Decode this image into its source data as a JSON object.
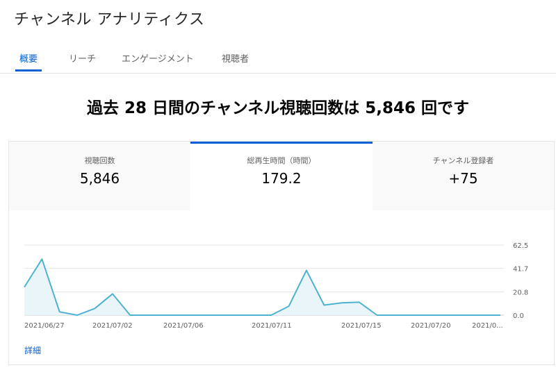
{
  "header": {
    "title": "チャンネル アナリティクス"
  },
  "tabs": [
    {
      "label": "概要",
      "active": true
    },
    {
      "label": "リーチ",
      "active": false
    },
    {
      "label": "エンゲージメント",
      "active": false
    },
    {
      "label": "視聴者",
      "active": false
    }
  ],
  "headline": "過去 28 日間のチャンネル視聴回数は 5,846 回です",
  "metrics": [
    {
      "label": "視聴回数",
      "value": "5,846",
      "active": false
    },
    {
      "label": "総再生時間（時間）",
      "value": "179.2",
      "active": true
    },
    {
      "label": "チャンネル登録者",
      "value": "+75",
      "active": false
    }
  ],
  "details_link": "詳細",
  "colors": {
    "accent": "#065fd4",
    "line": "#4db2d1",
    "fill": "#e8f4fa"
  },
  "chart_data": {
    "type": "area",
    "x_tick_labels": [
      "2021/06/27",
      "2021/07/02",
      "2021/07/06",
      "2021/07/11",
      "2021/07/15",
      "2021/07/20",
      "2021/0..."
    ],
    "y_ticks": [
      0.0,
      20.8,
      41.7,
      62.5
    ],
    "y_tick_labels": [
      "0.0",
      "20.8",
      "41.7",
      "62.5"
    ],
    "ylim": [
      0,
      62.5
    ],
    "x": [
      "2021/06/26",
      "2021/06/27",
      "2021/06/28",
      "2021/06/29",
      "2021/06/30",
      "2021/07/01",
      "2021/07/02",
      "2021/07/03",
      "2021/07/04",
      "2021/07/05",
      "2021/07/06",
      "2021/07/07",
      "2021/07/08",
      "2021/07/09",
      "2021/07/10",
      "2021/07/11",
      "2021/07/12",
      "2021/07/13",
      "2021/07/14",
      "2021/07/15",
      "2021/07/16",
      "2021/07/17",
      "2021/07/18",
      "2021/07/19",
      "2021/07/20",
      "2021/07/21",
      "2021/07/22",
      "2021/07/23"
    ],
    "values": [
      25,
      50,
      3,
      0,
      6,
      19,
      0,
      0,
      0,
      0,
      0,
      0,
      0,
      0,
      0,
      8,
      40,
      9,
      11,
      11.5,
      0,
      0,
      0,
      0,
      0,
      0,
      0,
      0
    ]
  }
}
